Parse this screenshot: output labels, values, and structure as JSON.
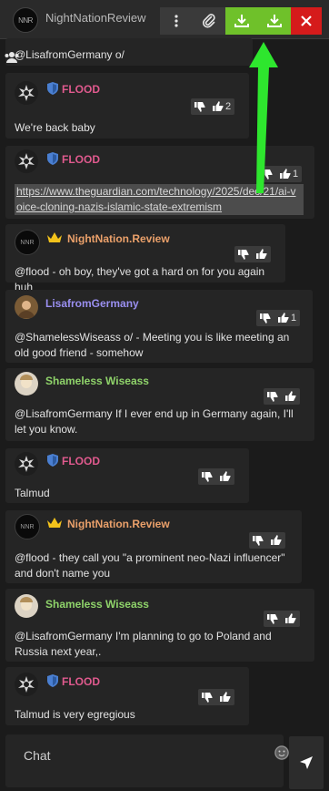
{
  "header": {
    "title": "NightNationReview",
    "logo_text": "NNR",
    "icons": [
      "more-vertical-icon",
      "paperclip-icon",
      "download-icon",
      "download-icon",
      "close-icon"
    ],
    "colors": {
      "download": "#6fc12a",
      "close": "#d51b1b"
    }
  },
  "top_partial_message": {
    "text": "@LisafromGermany o/"
  },
  "messages": [
    {
      "author": "FLOOD",
      "badge": "shield",
      "text": "We're back baby",
      "up": "2",
      "down": ""
    },
    {
      "author": "FLOOD",
      "badge": "shield",
      "link": "https://www.theguardian.com/technology/2025/dec/21/ai-voice-cloning-nazis-islamic-state-extremism",
      "up": "1",
      "down": ""
    },
    {
      "author": "NightNation.Review",
      "badge": "crown",
      "text": "@flood - oh boy, they've got a hard on for you again huh",
      "up": "",
      "down": ""
    },
    {
      "author": "LisafromGermany",
      "badge": "",
      "text": "@ShamelessWiseass o/ - Meeting you is like meeting an old good friend - somehow",
      "up": "1",
      "down": ""
    },
    {
      "author": "Shameless Wiseass",
      "badge": "",
      "text": "@LisafromGermany If I ever end up in Germany again, I'll let you know.",
      "up": "",
      "down": ""
    },
    {
      "author": "FLOOD",
      "badge": "shield",
      "text": "Talmud",
      "up": "",
      "down": ""
    },
    {
      "author": "NightNation.Review",
      "badge": "crown",
      "text": "@flood - they call you \"a prominent neo-Nazi influencer\" and don't name you",
      "up": "",
      "down": ""
    },
    {
      "author": "Shameless Wiseass",
      "badge": "",
      "text": "@LisafromGermany I'm planning to go to Poland and Russia next year,.",
      "up": "",
      "down": ""
    },
    {
      "author": "FLOOD",
      "badge": "shield",
      "text": "Talmud is very egregious",
      "up": "",
      "down": ""
    }
  ],
  "composer": {
    "placeholder": "Chat"
  }
}
